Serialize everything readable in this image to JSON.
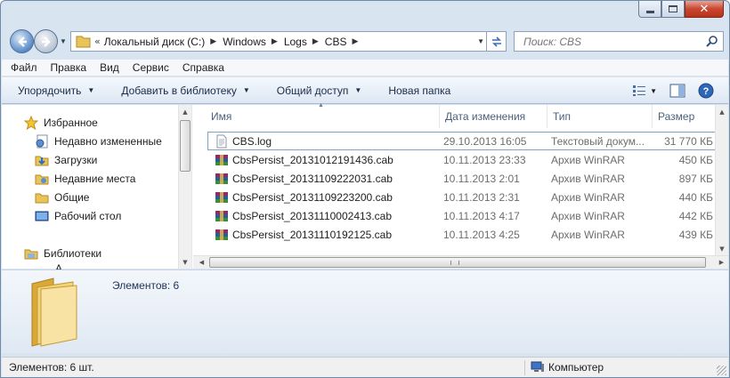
{
  "window": {
    "close_label": "✕"
  },
  "address": {
    "breadcrumbs": [
      "Локальный диск (C:)",
      "Windows",
      "Logs",
      "CBS"
    ]
  },
  "search": {
    "placeholder": "Поиск: CBS"
  },
  "menu": [
    "Файл",
    "Правка",
    "Вид",
    "Сервис",
    "Справка"
  ],
  "commands": {
    "organize": "Упорядочить",
    "add_library": "Добавить в библиотеку",
    "share": "Общий доступ",
    "new_folder": "Новая папка"
  },
  "nav": {
    "favorites": "Избранное",
    "recent": "Недавно измененные",
    "downloads": "Загрузки",
    "recent_places": "Недавние места",
    "shared": "Общие",
    "desktop": "Рабочий стол",
    "libraries": "Библиотеки",
    "partial": "А"
  },
  "columns": {
    "name": "Имя",
    "date": "Дата изменения",
    "type": "Тип",
    "size": "Размер"
  },
  "files": [
    {
      "name": "CBS.log",
      "date": "29.10.2013 16:05",
      "type": "Текстовый докум...",
      "size": "31 770 КБ",
      "icon": "text-file-icon"
    },
    {
      "name": "CbsPersist_20131012191436.cab",
      "date": "10.11.2013 23:33",
      "type": "Архив WinRAR",
      "size": "450 КБ",
      "icon": "winrar-archive-icon"
    },
    {
      "name": "CbsPersist_20131109222031.cab",
      "date": "10.11.2013 2:01",
      "type": "Архив WinRAR",
      "size": "897 КБ",
      "icon": "winrar-archive-icon"
    },
    {
      "name": "CbsPersist_20131109223200.cab",
      "date": "10.11.2013 2:31",
      "type": "Архив WinRAR",
      "size": "440 КБ",
      "icon": "winrar-archive-icon"
    },
    {
      "name": "CbsPersist_20131110002413.cab",
      "date": "10.11.2013 4:17",
      "type": "Архив WinRAR",
      "size": "442 КБ",
      "icon": "winrar-archive-icon"
    },
    {
      "name": "CbsPersist_20131110192125.cab",
      "date": "10.11.2013 4:25",
      "type": "Архив WinRAR",
      "size": "439 КБ",
      "icon": "winrar-archive-icon"
    }
  ],
  "details": {
    "count": "Элементов: 6"
  },
  "status": {
    "left": "Элементов: 6 шт.",
    "right": "Компьютер"
  }
}
